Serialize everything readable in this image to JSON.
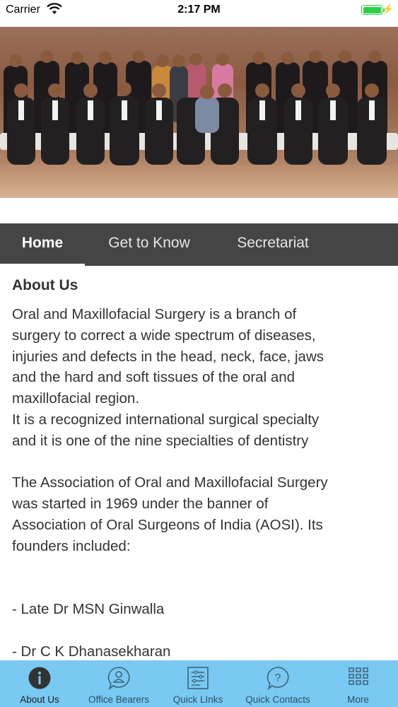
{
  "status_bar": {
    "carrier": "Carrier",
    "time": "2:17 PM",
    "battery_color": "#2fcf4a"
  },
  "hero": {
    "image": "group-photo"
  },
  "tabs": [
    {
      "label": "Home",
      "active": true
    },
    {
      "label": "Get to Know",
      "active": false
    },
    {
      "label": "Secretariat",
      "active": false
    }
  ],
  "content": {
    "heading": "About Us",
    "body": "Oral and Maxillofacial Surgery is a branch of\nsurgery to correct a wide spectrum of diseases,\ninjuries and defects in the head, neck, face, jaws\nand the hard and soft tissues of the oral and\nmaxillofacial region.\nIt is a recognized international surgical specialty\nand it is one of the nine specialties of dentistry\n\nThe Association of Oral and Maxillofacial Surgery\nwas started in 1969 under the banner of\nAssociation of Oral Surgeons of India (AOSI). Its\nfounders included:\n\n\n- Late Dr MSN Ginwalla\n\n- Dr C K Dhanasekharan"
  },
  "bottom_nav": {
    "background": "#79c9f2",
    "items": [
      {
        "label": "About Us",
        "icon": "info-icon",
        "active": true
      },
      {
        "label": "Office Bearers",
        "icon": "person-bubble-icon",
        "active": false
      },
      {
        "label": "Quick LInks",
        "icon": "document-list-icon",
        "active": false
      },
      {
        "label": "Quick Contacts",
        "icon": "question-bubble-icon",
        "active": false
      },
      {
        "label": "More",
        "icon": "grid-icon",
        "active": false
      }
    ]
  }
}
